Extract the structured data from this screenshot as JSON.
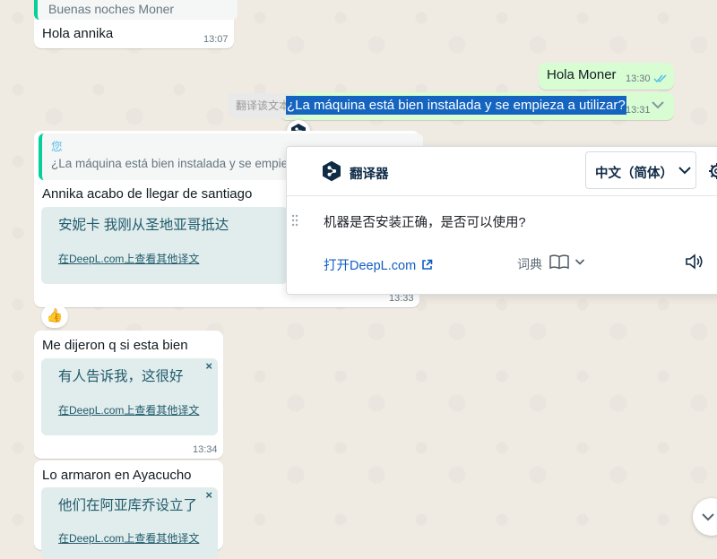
{
  "messages": {
    "m1": {
      "quoted_text": "Buenas noches Moner",
      "text": "Hola annika",
      "time": "13:07"
    },
    "m2": {
      "text": "Hola Moner",
      "time": "13:30"
    },
    "m3": {
      "selected_text": "¿La máquina está bien instalada y se empieza a utilizar?",
      "time": "13:31"
    },
    "m4": {
      "quoted_sender": "您",
      "quoted_text": "¿La máquina está bien instalada y se empie",
      "text": "Annika acabo de llegar de santiago",
      "translation": "安妮卡 我刚从圣地亚哥抵达",
      "more_link": "在DeepL.com上查看其他译文",
      "time": "13:33",
      "reaction": "👍"
    },
    "m5": {
      "text": "Me dijeron q si esta bien",
      "translation": "有人告诉我，这很好",
      "more_link": "在DeepL.com上查看其他译文",
      "close": "×",
      "time": "13:34"
    },
    "m6": {
      "text": "Lo armaron en Ayacucho",
      "translation": "他们在阿亚库乔设立了",
      "more_link": "在DeepL.com上查看其他译文",
      "close": "×"
    }
  },
  "tooltip": {
    "label": "翻译该文本"
  },
  "deepl_popup": {
    "title": "翻译器",
    "target_language": "中文（简体）",
    "result": "机器是否安装正确，是否可以使用?",
    "open_link": "打开DeepL.com",
    "dictionary_label": "词典"
  },
  "icons": {
    "deepl_logo": "deepl-logo-icon",
    "read_ticks": "double-check-icon",
    "chevron": "chevron-down-icon",
    "book": "book-icon",
    "speaker": "speaker-icon",
    "gear": "gear-icon",
    "external": "external-link-icon",
    "drag": "drag-handle-icon"
  },
  "colors": {
    "chat_bg": "#efeae2",
    "outgoing_bubble": "#d9fdd3",
    "incoming_bubble": "#ffffff",
    "selection": "#1565c0",
    "deepl_navy": "#0f2b46",
    "link_blue": "#0f5ec2",
    "translation_box": "#e1ecec",
    "read_tick": "#53bdeb"
  }
}
